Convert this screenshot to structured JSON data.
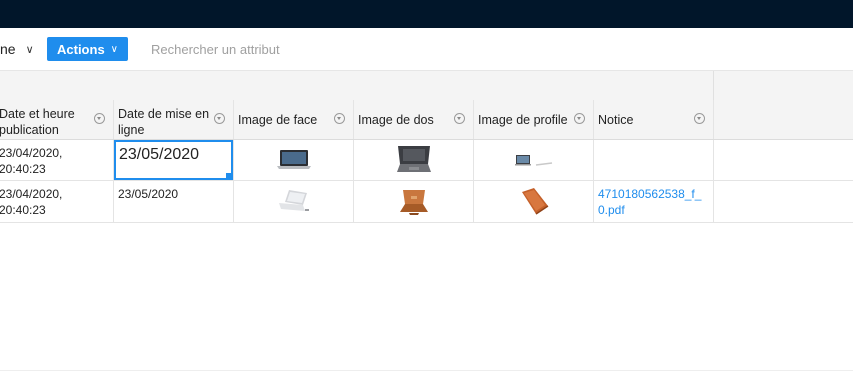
{
  "toolbar": {
    "view_label": "ne",
    "actions_label": "Actions",
    "search_placeholder": "Rechercher un attribut"
  },
  "columns": [
    {
      "label": "Date et heure publication"
    },
    {
      "label": "Date de mise en ligne"
    },
    {
      "label": "Image de face"
    },
    {
      "label": "Image de dos"
    },
    {
      "label": "Image de profile"
    },
    {
      "label": "Notice"
    }
  ],
  "rows": [
    {
      "date_publication": "23/04/2020, 20:40:23",
      "date_mise_en_ligne": "23/05/2020",
      "image_face": "laptop-front-dark",
      "image_dos": "laptop-back-dark",
      "image_profile": "laptop-side-dark",
      "notice": ""
    },
    {
      "date_publication": "23/04/2020, 20:40:23",
      "date_mise_en_ligne": "23/05/2020",
      "image_face": "laptop-front-silver",
      "image_dos": "laptop-back-copper",
      "image_profile": "laptop-side-copper",
      "notice": "4710180562538_f_0.pdf"
    }
  ],
  "colors": {
    "topbar": "#01162a",
    "accent": "#1f8ded",
    "header_bg": "#f4f4f4"
  }
}
